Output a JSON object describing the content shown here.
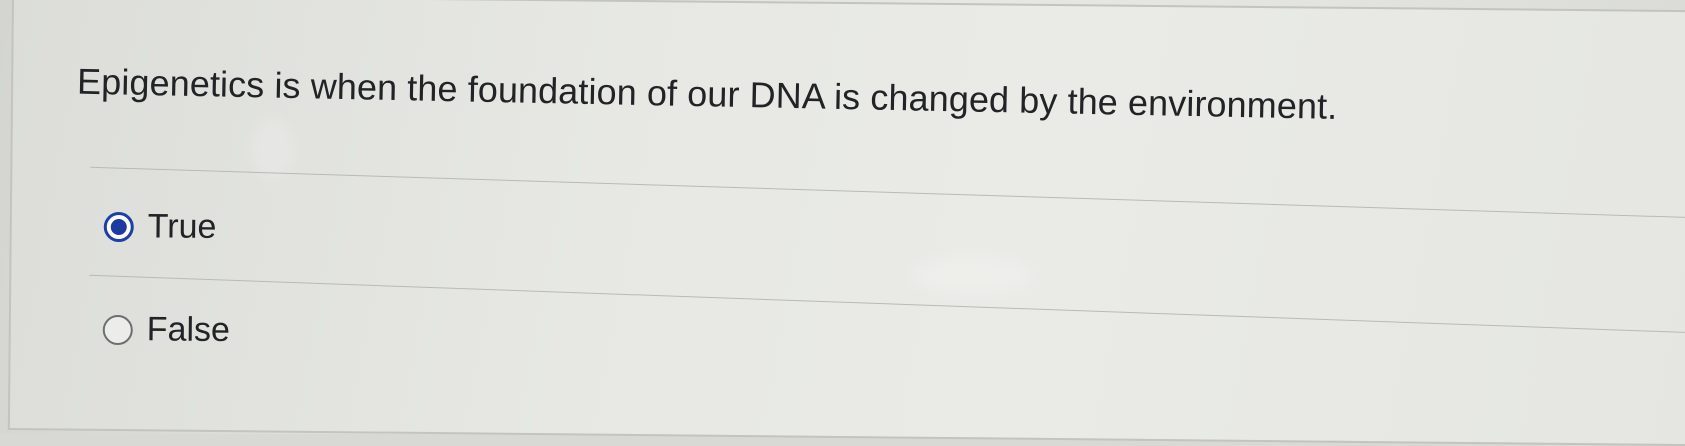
{
  "question": {
    "text": "Epigenetics is when the foundation of our DNA is changed by the environment."
  },
  "options": [
    {
      "label": "True",
      "selected": true
    },
    {
      "label": "False",
      "selected": false
    }
  ],
  "colors": {
    "selected_radio": "#1d3aa0",
    "text": "#222326",
    "divider": "#b9bab6"
  }
}
